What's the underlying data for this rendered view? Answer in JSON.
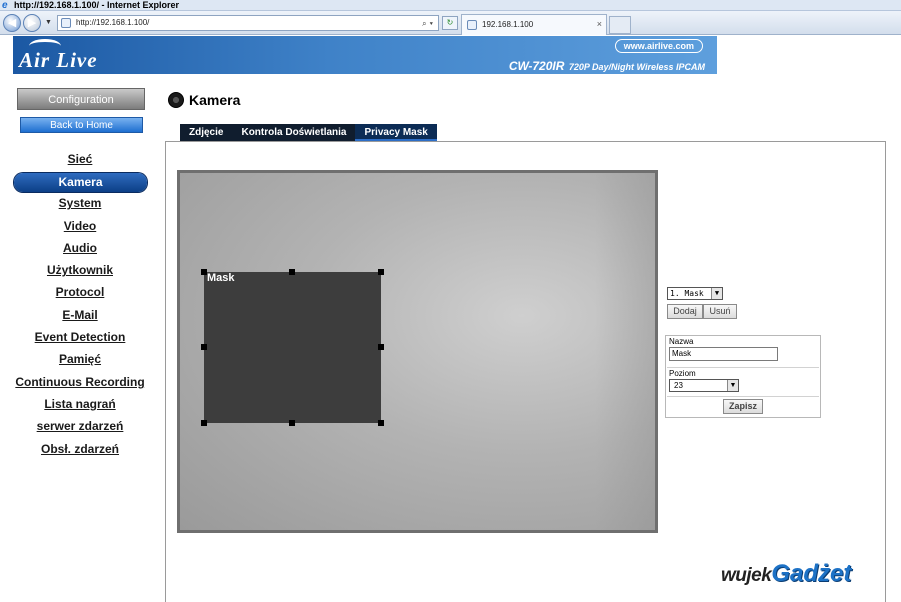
{
  "browser": {
    "window_title": "http://192.168.1.100/ - Internet Explorer",
    "address": "http://192.168.1.100/",
    "tab_title": "192.168.1.100",
    "tab_close": "×"
  },
  "banner": {
    "brand": "Air Live",
    "url": "www.airlive.com",
    "model": "CW-720IR",
    "model_desc": "720P Day/Night Wireless IPCAM"
  },
  "sidebar": {
    "config_label": "Configuration",
    "home_label": "Back to Home",
    "items": [
      {
        "label": "Sieć",
        "active": false
      },
      {
        "label": "Kamera",
        "active": true
      },
      {
        "label": "System",
        "active": false
      },
      {
        "label": "Video",
        "active": false
      },
      {
        "label": "Audio",
        "active": false
      },
      {
        "label": "Użytkownik",
        "active": false
      },
      {
        "label": "Protocol",
        "active": false
      },
      {
        "label": "E-Mail",
        "active": false
      },
      {
        "label": "Event Detection",
        "active": false
      },
      {
        "label": "Pamięć",
        "active": false
      },
      {
        "label": "Continuous Recording",
        "active": false
      },
      {
        "label": "Lista nagrań",
        "active": false
      },
      {
        "label": "serwer zdarzeń",
        "active": false
      },
      {
        "label": "Obsł. zdarzeń",
        "active": false
      }
    ]
  },
  "main": {
    "title": "Kamera",
    "tabs": [
      {
        "label": "Zdjęcie",
        "active": false
      },
      {
        "label": "Kontrola Doświetlania",
        "active": false
      },
      {
        "label": "Privacy Mask",
        "active": true
      }
    ]
  },
  "video": {
    "mask_label": "Mask"
  },
  "controls": {
    "mask_select_value": "1. Mask",
    "add_label": "Dodaj",
    "delete_label": "Usuń",
    "name_label": "Nazwa",
    "name_value": "Mask",
    "level_label": "Poziom",
    "level_value": "23",
    "save_label": "Zapisz"
  },
  "watermark": {
    "part1": "wujek",
    "part2": "Gadżet"
  },
  "colors": {
    "banner_blue": "#1b58a3",
    "active_nav": "#0c3f86",
    "mask_fill": "#3d3d3d",
    "tab_bar": "#101d2e",
    "watermark_blue": "#1d72c6"
  }
}
